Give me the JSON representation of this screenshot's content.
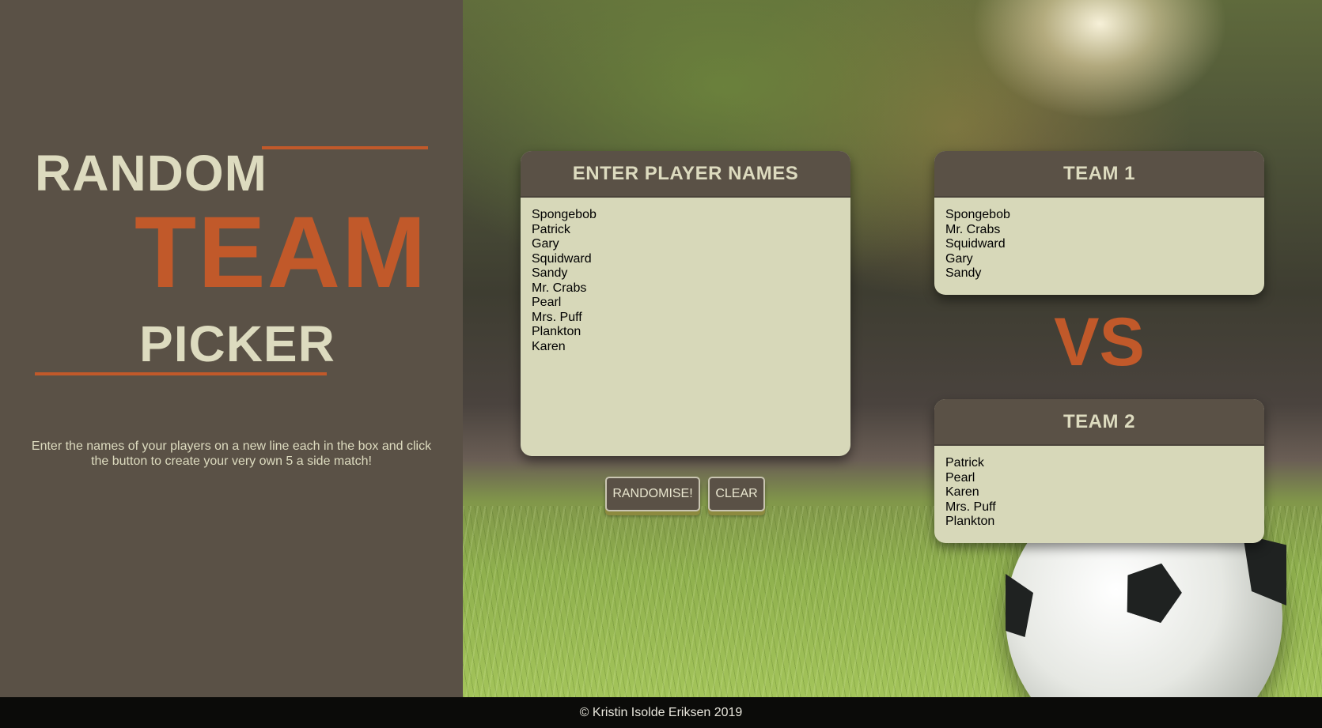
{
  "sidebar": {
    "title_random": "RANDOM",
    "title_team": "TEAM",
    "title_picker": "PICKER",
    "intro": "Enter the names of your players on a new line each in the box and click the button to create your very own 5 a side match!"
  },
  "input_panel": {
    "heading": "ENTER PLAYER NAMES",
    "value": "Spongebob\nPatrick\nGary\nSquidward\nSandy\nMr. Crabs\nPearl\nMrs. Puff\nPlankton\nKaren"
  },
  "buttons": {
    "randomise_label": "RANDOMISE!",
    "clear_label": "CLEAR"
  },
  "team1": {
    "heading": "TEAM 1",
    "players": [
      "Spongebob",
      "Mr. Crabs",
      "Squidward",
      "Gary",
      "Sandy"
    ]
  },
  "versus": "VS",
  "team2": {
    "heading": "TEAM 2",
    "players": [
      "Patrick",
      "Pearl",
      "Karen",
      "Mrs. Puff",
      "Plankton"
    ]
  },
  "footer": {
    "copyright": "© Kristin Isolde Eriksen 2019"
  },
  "colors": {
    "sidebar_bg": "#5a5146",
    "accent": "#c1592a",
    "light_text": "#dddbbf",
    "panel_body": "#d7d8b9"
  }
}
